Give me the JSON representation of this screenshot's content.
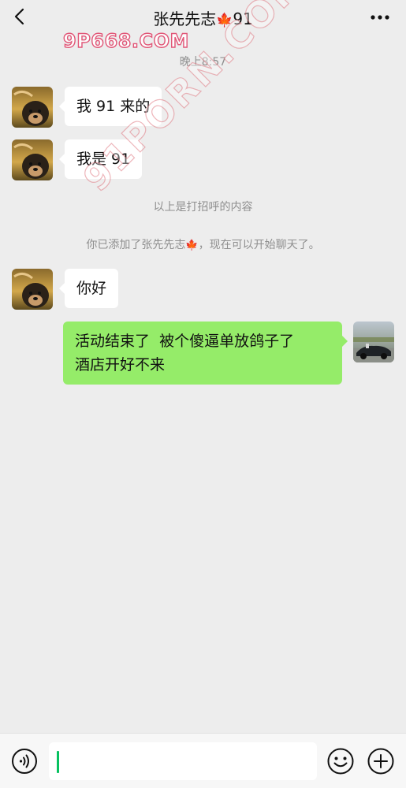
{
  "header": {
    "title": "张先先志",
    "title_suffix": "91",
    "leaf_icon": "maple-leaf-emoji"
  },
  "watermarks": {
    "top": "9P668.COM",
    "diagonal": "91PORN.COM"
  },
  "chat": {
    "timestamp": "晚上8:57",
    "messages": [
      {
        "side": "left",
        "text": "我 91 来的"
      },
      {
        "side": "left",
        "text": "我是 91"
      }
    ],
    "greeting_note": "以上是打招呼的内容",
    "added_notice_prefix": "你已添加了张先先志",
    "added_notice_suffix": "，现在可以开始聊天了。",
    "message_hello": "你好",
    "message_sent_line1": "活动结束了  被个傻逼单放鸽子了",
    "message_sent_line2": "酒店开好不来"
  },
  "input_bar": {
    "value": "",
    "placeholder": ""
  },
  "colors": {
    "background": "#ededed",
    "bubble_received": "#ffffff",
    "bubble_sent": "#95ec69",
    "accent": "#07c160",
    "watermark": "#e0466b"
  },
  "icons": [
    "back-arrow-icon",
    "more-icon",
    "voice-icon",
    "emoji-icon",
    "plus-icon"
  ]
}
